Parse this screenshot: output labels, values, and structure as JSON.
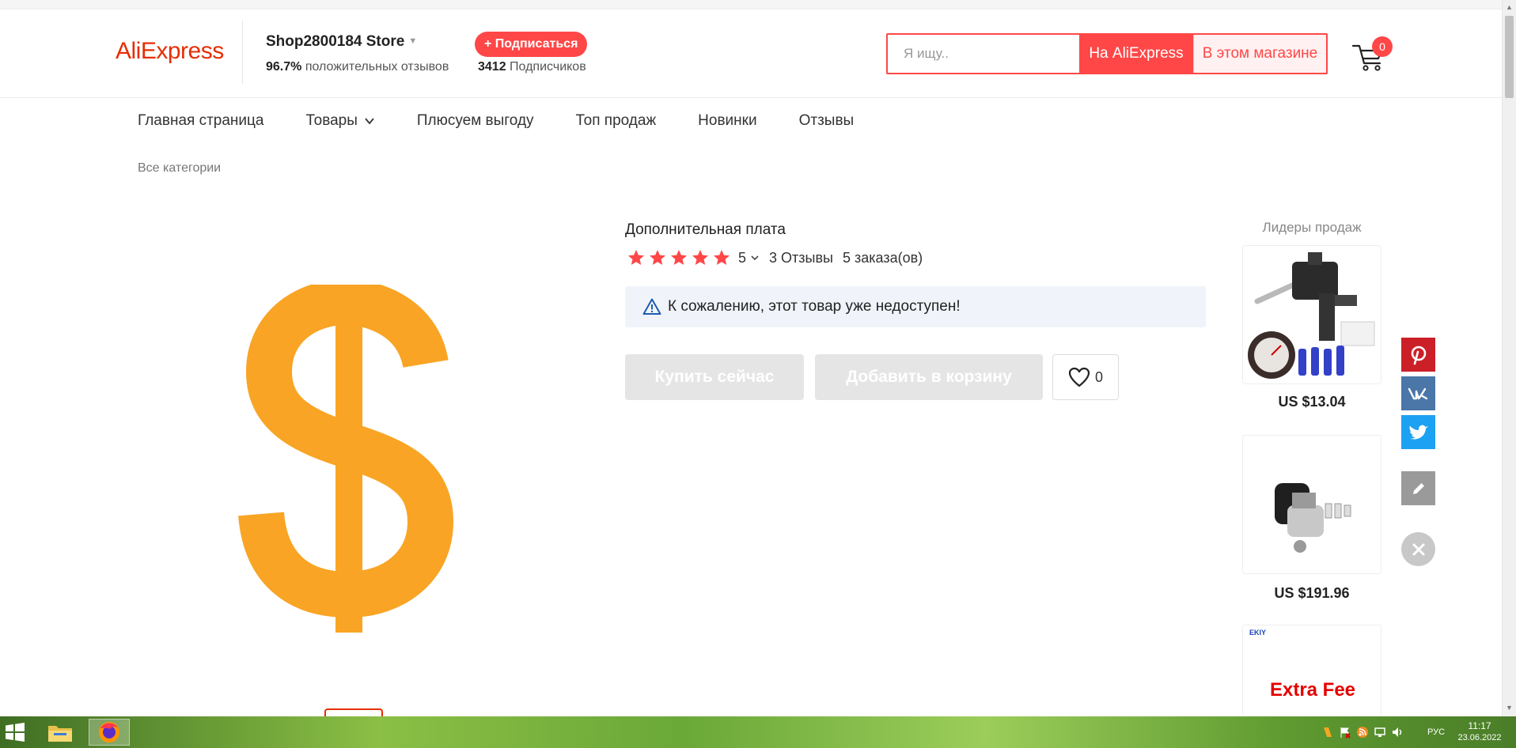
{
  "header": {
    "logo": "AliExpress",
    "store_name": "Shop2800184 Store",
    "rating_percent": "96.7%",
    "rating_text": "положительных отзывов",
    "subscribe_label": "+ Подписаться",
    "followers_count": "3412",
    "followers_text": "Подписчиков",
    "search_placeholder": "Я ищу..",
    "search_aliexpress_label": "На AliExpress",
    "search_store_label": "В этом магазине",
    "cart_count": "0"
  },
  "nav": {
    "items": [
      "Главная страница",
      "Товары",
      "Плюсуем выгоду",
      "Топ продаж",
      "Новинки",
      "Отзывы"
    ],
    "all_categories": "Все категории"
  },
  "product": {
    "title": "Дополнительная плата",
    "rating": "5",
    "reviews": "3 Отзывы",
    "orders": "5 заказа(ов)",
    "unavailable_notice": "К сожалению, этот товар уже недоступен!",
    "buy_now_label": "Купить сейчас",
    "add_to_cart_label": "Добавить в корзину",
    "wishlist_count": "0",
    "image_color": "#f9a424"
  },
  "best_sellers": {
    "title": "Лидеры продаж",
    "items": [
      {
        "price": "US $13.04"
      },
      {
        "price": "US $191.96"
      },
      {
        "brand": "EKIY",
        "label": "Extra Fee"
      }
    ]
  },
  "share": {
    "colors": {
      "pinterest": "#cb2027",
      "vk": "#4a76a8",
      "twitter": "#1da1f2",
      "edit": "#9a9a9a"
    }
  },
  "taskbar": {
    "language": "РУС",
    "time": "11:17",
    "date": "23.06.2022"
  },
  "colors": {
    "accent": "#ff4747",
    "brand": "#e62e04"
  }
}
